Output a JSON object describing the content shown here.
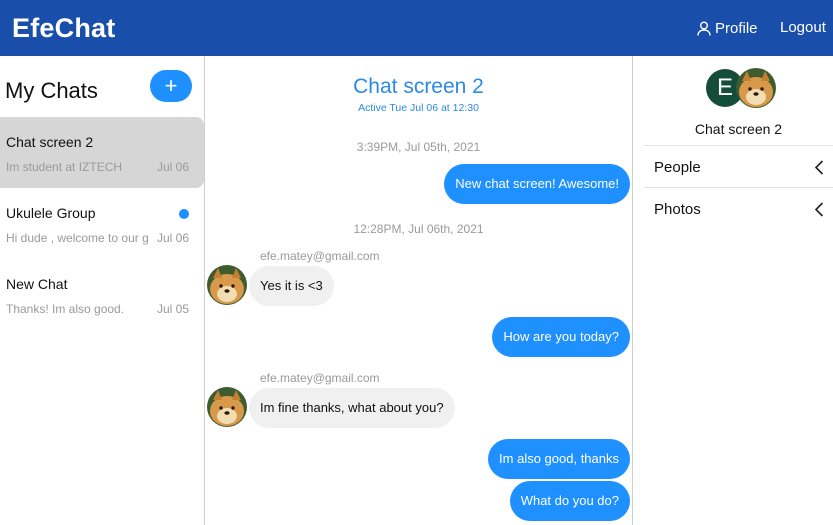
{
  "app": {
    "title": "EfeChat"
  },
  "nav": {
    "profile": "Profile",
    "logout": "Logout"
  },
  "sidebar": {
    "title": "My Chats",
    "new_label": "+",
    "chats": [
      {
        "title": "Chat screen 2",
        "preview": "Im student at IZTECH",
        "date": "Jul 06",
        "active": true,
        "unread": false
      },
      {
        "title": "Ukulele Group",
        "preview": "Hi dude , welcome to our group",
        "date": "Jul 06",
        "active": false,
        "unread": true
      },
      {
        "title": "New Chat",
        "preview": "Thanks! Im also good.",
        "date": "Jul 05",
        "active": false,
        "unread": false
      }
    ]
  },
  "chat": {
    "title": "Chat screen 2",
    "active": "Active Tue Jul 06 at 12:30",
    "timestamps": [
      "3:39PM, Jul 05th, 2021",
      "12:28PM, Jul 06th, 2021"
    ],
    "messages": [
      {
        "text": "New chat screen! Awesome!",
        "out": true
      },
      {
        "sender": "efe.matey@gmail.com",
        "text": "Yes it is <3",
        "out": false
      },
      {
        "text": "How are you today?",
        "out": true
      },
      {
        "sender": "efe.matey@gmail.com",
        "text": "Im fine thanks, what about you?",
        "out": false
      },
      {
        "text": "Im also good, thanks",
        "out": true
      },
      {
        "text": "What do you do?",
        "out": true
      }
    ]
  },
  "details": {
    "avatar_letter": "E",
    "name": "Chat screen 2",
    "sections": [
      {
        "label": "People"
      },
      {
        "label": "Photos"
      }
    ]
  },
  "colors": {
    "topbar": "#1a4eab",
    "accent": "#1e90ff",
    "active_chat": "#d6d6d6",
    "avatar_letter_bg": "#154d3b"
  },
  "icons": {
    "profile": "user-outline-icon",
    "section_toggle": "chevron-left-icon",
    "avatar": "doge-avatar-icon"
  }
}
